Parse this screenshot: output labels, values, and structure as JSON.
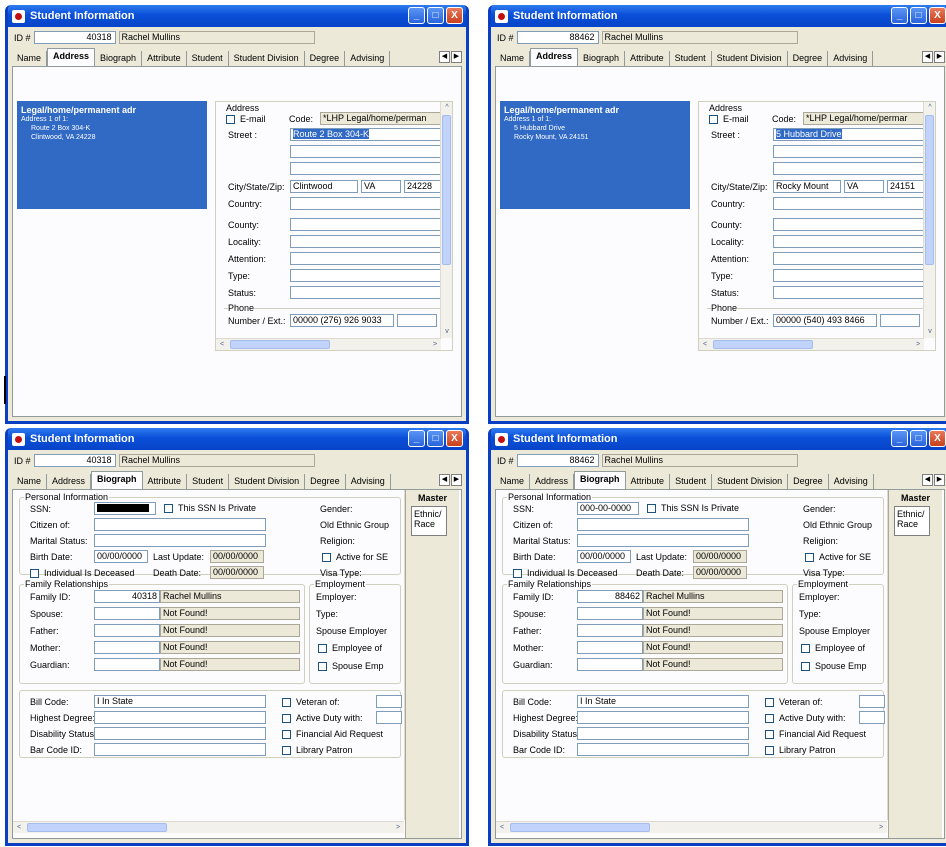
{
  "window_title": "Student Information",
  "id_label": "ID #",
  "tabs": [
    "Name",
    "Address",
    "Biograph",
    "Attribute",
    "Student",
    "Student Division",
    "Degree",
    "Advising"
  ],
  "window_buttons": {
    "minimize": "_",
    "maximize": "□",
    "close": "X"
  },
  "address_labels": {
    "group": "Address",
    "email": "E-mail",
    "code": "Code:",
    "street": "Street :",
    "citystatezip": "City/State/Zip:",
    "country": "Country:",
    "county": "County:",
    "locality": "Locality:",
    "attention": "Attention:",
    "type": "Type:",
    "status": "Status:",
    "phone_group": "Phone",
    "phone": "Number / Ext.:"
  },
  "biograph_labels": {
    "personal": "Personal Information",
    "ssn": "SSN:",
    "ssn_private": "This SSN Is Private",
    "citizen": "Citizen of:",
    "marital": "Marital Status:",
    "birth": "Birth Date:",
    "last_update": "Last Update:",
    "deceased": "Individual Is Deceased",
    "death": "Death Date:",
    "gender": "Gender:",
    "ethnic": "Old Ethnic Group",
    "religion": "Religion:",
    "active": "Active for SE",
    "visa": "Visa Type:",
    "family": "Family Relationships",
    "family_id": "Family ID:",
    "spouse": "Spouse:",
    "father": "Father:",
    "mother": "Mother:",
    "guardian": "Guardian:",
    "employment": "Employment",
    "employer": "Employer:",
    "emp_type": "Type:",
    "spouse_employer": "Spouse Employer",
    "employee_of": "Employee of",
    "spouse_emp": "Spouse Emp",
    "bill_code": "Bill Code:",
    "highest_degree": "Highest Degree:",
    "disability": "Disability Status:",
    "barcode": "Bar Code ID:",
    "veteran": "Veteran of:",
    "active_duty": "Active Duty with:",
    "finaid": "Financial Aid Request",
    "library": "Library Patron",
    "master": "Master",
    "ethnic_btn_1": "Ethnic/",
    "ethnic_btn_2": "Race",
    "not_found": "Not Found!",
    "date_blank": "00/00/0000",
    "bill_value": "I In State"
  },
  "windows": [
    {
      "id": "40318",
      "name": "Rachel Mullins",
      "active_tab": "Address",
      "addr_header": "Legal/home/permanent adr",
      "addr_count": "Address 1 of 1:",
      "addr_line1": "Route 2 Box 304-K",
      "addr_line2": "Clintwood, VA  24228",
      "code": "*LHP  Legal/home/perman",
      "street": "Route 2 Box 304-K",
      "city": "Clintwood",
      "state": "VA",
      "zip": "24228",
      "phone": "00000 (276) 926 9033"
    },
    {
      "id": "88462",
      "name": "Rachel Mullins",
      "active_tab": "Address",
      "addr_header": "Legal/home/permanent adr",
      "addr_count": "Address 1 of 1:",
      "addr_line1": "5 Hubbard Drive",
      "addr_line2": "Rocky Mount, VA  24151",
      "code": "*LHP  Legal/home/permar",
      "street": "5 Hubbard Drive",
      "city": "Rocky Mount",
      "state": "VA",
      "zip": "24151",
      "phone": "00000 (540) 493 8466"
    },
    {
      "id": "40318",
      "name": "Rachel Mullins",
      "active_tab": "Biograph",
      "ssn": "",
      "family_id": "40318",
      "family_name": "Rachel Mullins"
    },
    {
      "id": "88462",
      "name": "Rachel Mullins",
      "active_tab": "Biograph",
      "ssn": "000-00-0000",
      "family_id": "88462",
      "family_name": "Rachel Mullins"
    }
  ]
}
